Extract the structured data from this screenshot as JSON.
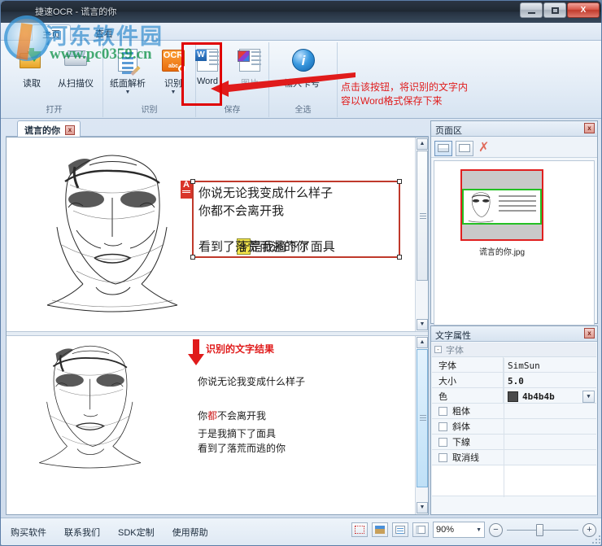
{
  "window": {
    "title": "捷速OCR - 谎言的你",
    "minimize_label": "最小化",
    "maximize_label": "最大化",
    "close_label": "X"
  },
  "watermark": {
    "site_cn": "河东软件园",
    "site_url": "www.pc0359.cn"
  },
  "tabs": [
    {
      "label": "主页",
      "active": true
    },
    {
      "label": "查看",
      "active": false
    }
  ],
  "ribbon": {
    "groups": [
      {
        "label": "打开",
        "buttons": [
          {
            "label": "读取",
            "icon": "open-folder-icon",
            "dropdown": false
          },
          {
            "label": "从扫描仪",
            "icon": "scanner-icon",
            "dropdown": false
          }
        ]
      },
      {
        "label": "识别",
        "buttons": [
          {
            "label": "纸面解析",
            "icon": "page-analysis-icon",
            "dropdown": true
          },
          {
            "label": "识别",
            "icon": "ocr-icon",
            "dropdown": true
          }
        ]
      },
      {
        "label": "保存",
        "buttons": [
          {
            "label": "Word",
            "icon": "word-doc-icon",
            "dropdown": false,
            "highlighted": true
          },
          {
            "label": "图片",
            "icon": "image-doc-icon",
            "dropdown": false
          }
        ]
      },
      {
        "label": "全选",
        "buttons": [
          {
            "label": "输入卡号",
            "icon": "info-icon",
            "dropdown": false
          }
        ]
      }
    ]
  },
  "annotations": {
    "ribbon_note": "点击该按钮，将识别的文字内\n容以Word格式保存下来",
    "result_note": "识别的文字结果",
    "color": "#e01b1b"
  },
  "document": {
    "tab_label": "谎言的你",
    "tab_close": "x",
    "ocr_zone": {
      "badge": "A",
      "lines": [
        "你说无论我变成什么样子",
        "你都不会离开我",
        "于是我摘下了面具",
        "看到了落荒而逃的你"
      ],
      "highlighted_char": "于"
    },
    "result_lines": [
      "你说无论我变成什么样子",
      "",
      "你都不会离开我",
      "于是我摘下了面具",
      "看到了落荒而逃的你"
    ]
  },
  "page_panel": {
    "title": "页面区",
    "close": "x",
    "toolbar": [
      {
        "name": "thumbnail-view-button",
        "selected": true
      },
      {
        "name": "list-view-button",
        "selected": false
      },
      {
        "name": "delete-page-button",
        "glyph": "✗"
      }
    ],
    "thumbnail_caption": "谎言的你.jpg",
    "selection_border_color": "#e02020",
    "zone_border_color": "#24c024"
  },
  "font_panel": {
    "title": "文字属性",
    "close": "x",
    "group_label": "字体",
    "group_toggle": "-",
    "rows": [
      {
        "key": "字体",
        "value": "SimSun",
        "bold": false
      },
      {
        "key": "大小",
        "value": "5.0",
        "bold": true
      },
      {
        "key": "色",
        "value": "4b4b4b",
        "bold": true,
        "swatch": "#4b4b4b",
        "dropdown": true
      }
    ],
    "checkboxes": [
      {
        "label": "粗体",
        "checked": false
      },
      {
        "label": "斜体",
        "checked": false
      },
      {
        "label": "下線",
        "checked": false
      },
      {
        "label": "取消线",
        "checked": false
      }
    ]
  },
  "statusbar": {
    "links": [
      "购买软件",
      "联系我们",
      "SDK定制",
      "使用帮助"
    ],
    "view_modes": [
      "fit-page-view",
      "image-view",
      "text-view",
      "split-view"
    ],
    "zoom_value": "90%",
    "zoom_out": "−",
    "zoom_in": "+"
  }
}
